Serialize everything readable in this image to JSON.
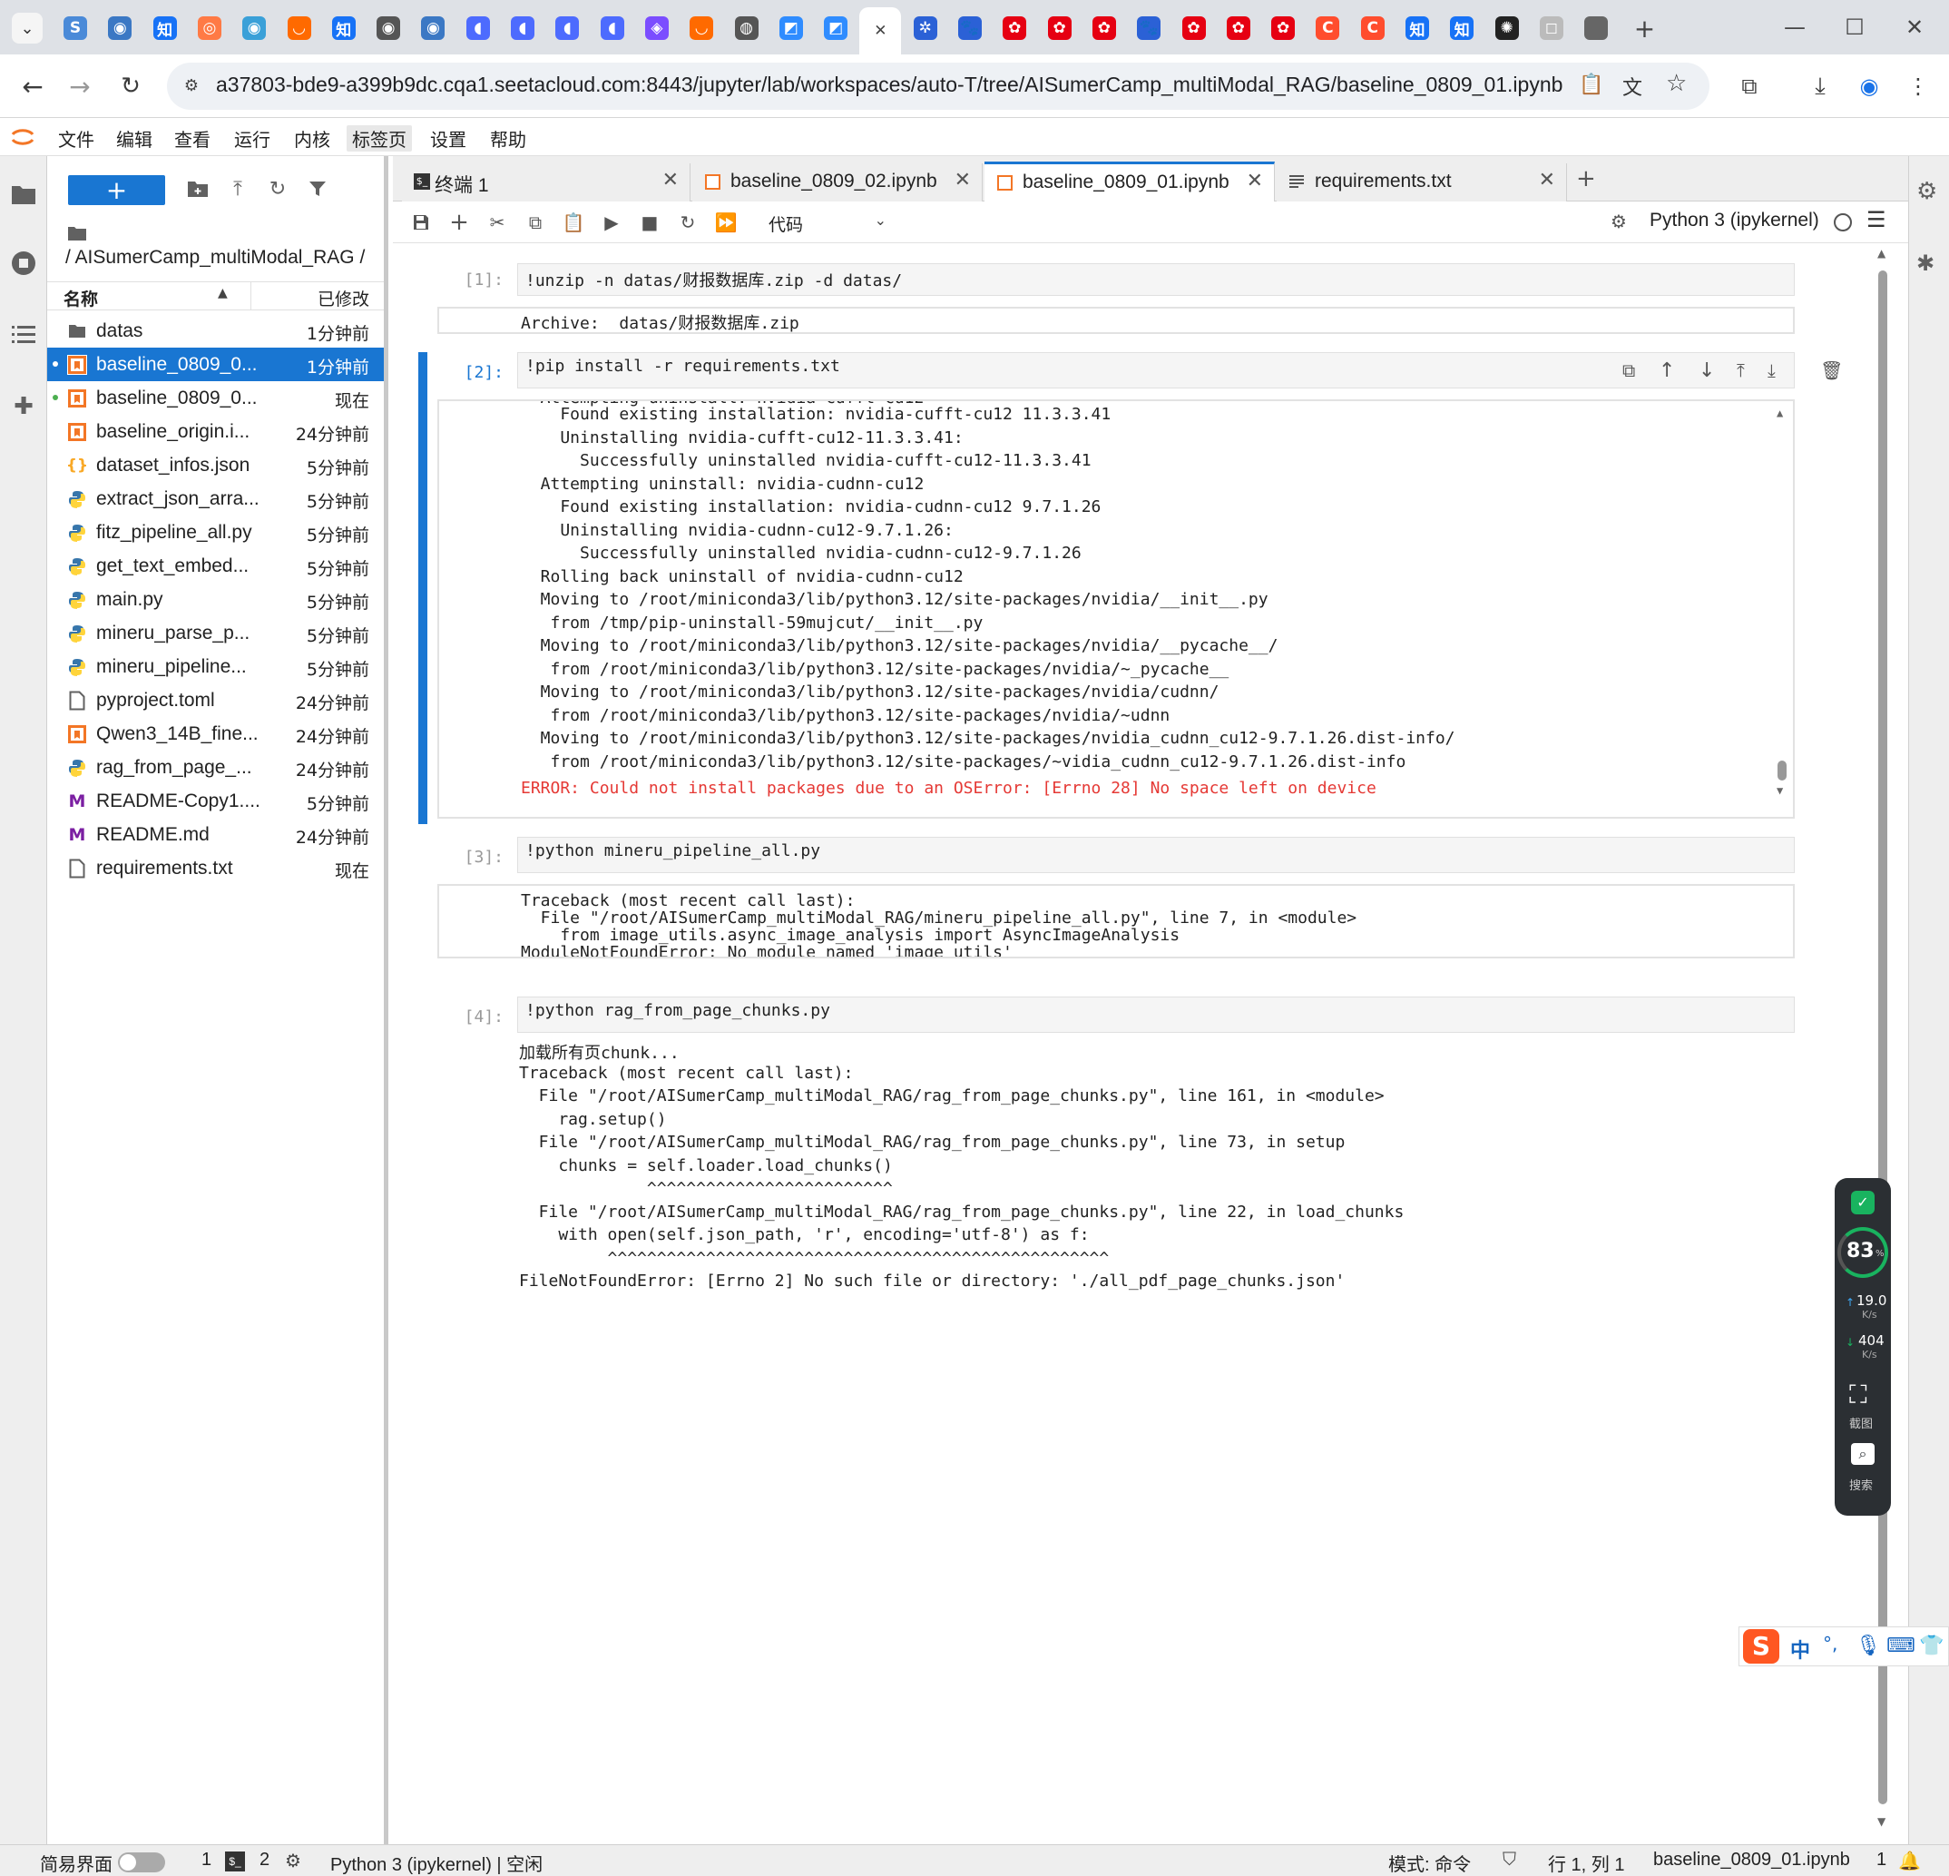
{
  "browser": {
    "url": "a37803-bde9-a399b9dc.cqa1.seetacloud.com:8443/jupyter/lab/workspaces/auto-T/tree/AISumerCamp_multiModal_RAG/baseline_0809_01.ipynb",
    "tabs": [
      {
        "icon": "S",
        "color": "#4a8ad8"
      },
      {
        "icon": "◉",
        "color": "#3b78c4"
      },
      {
        "icon": "知",
        "color": "#1772f6"
      },
      {
        "icon": "◎",
        "color": "#ff7a45"
      },
      {
        "icon": "◉",
        "color": "#3aa0d8"
      },
      {
        "icon": "◡",
        "color": "#ff6a00"
      },
      {
        "icon": "知",
        "color": "#1772f6"
      },
      {
        "icon": "◉",
        "color": "#555555"
      },
      {
        "icon": "◉",
        "color": "#3b78c4"
      },
      {
        "icon": "◖",
        "color": "#4d6bfe"
      },
      {
        "icon": "◖",
        "color": "#4d6bfe"
      },
      {
        "icon": "◖",
        "color": "#4d6bfe"
      },
      {
        "icon": "◖",
        "color": "#4d6bfe"
      },
      {
        "icon": "◈",
        "color": "#7b4dff"
      },
      {
        "icon": "◡",
        "color": "#ff6a00"
      },
      {
        "icon": "◍",
        "color": "#555555"
      },
      {
        "icon": "◩",
        "color": "#2f8cff"
      },
      {
        "icon": "◩",
        "color": "#2f8cff"
      },
      {
        "icon": "✕",
        "color": "#444444"
      },
      {
        "icon": "✲",
        "color": "#2b61d6"
      },
      {
        "icon": "🐾",
        "color": "#2b61d6"
      },
      {
        "icon": "✿",
        "color": "#e60012"
      },
      {
        "icon": "✿",
        "color": "#e60012"
      },
      {
        "icon": "✿",
        "color": "#e60012"
      },
      {
        "icon": "🐾",
        "color": "#2b61d6"
      },
      {
        "icon": "✿",
        "color": "#e60012"
      },
      {
        "icon": "✿",
        "color": "#e60012"
      },
      {
        "icon": "✿",
        "color": "#e60012"
      },
      {
        "icon": "C",
        "color": "#ff4d2e"
      },
      {
        "icon": "C",
        "color": "#ff4d2e"
      },
      {
        "icon": "知",
        "color": "#1772f6"
      },
      {
        "icon": "知",
        "color": "#1772f6"
      },
      {
        "icon": "✺",
        "color": "#222222"
      },
      {
        "icon": "◻",
        "color": "#bbbbbb"
      },
      {
        "icon": "",
        "color": "#666666"
      }
    ],
    "new_tab": "+"
  },
  "menubar": {
    "items": [
      "文件",
      "编辑",
      "查看",
      "运行",
      "内核",
      "标签页",
      "设置",
      "帮助"
    ]
  },
  "filebrowser": {
    "new_label": "+",
    "breadcrumb": "/ AISumerCamp_multiModal_RAG /",
    "col_name": "名称",
    "col_modified": "已修改",
    "files": [
      {
        "name": "datas",
        "modified": "1分钟前",
        "type": "folder",
        "selected": false,
        "running": false
      },
      {
        "name": "baseline_0809_0...",
        "modified": "1分钟前",
        "type": "notebook",
        "selected": true,
        "running": true
      },
      {
        "name": "baseline_0809_0...",
        "modified": "现在",
        "type": "notebook",
        "selected": false,
        "running": true
      },
      {
        "name": "baseline_origin.i...",
        "modified": "24分钟前",
        "type": "notebook",
        "selected": false,
        "running": false
      },
      {
        "name": "dataset_infos.json",
        "modified": "5分钟前",
        "type": "json",
        "selected": false,
        "running": false
      },
      {
        "name": "extract_json_arra...",
        "modified": "5分钟前",
        "type": "python",
        "selected": false,
        "running": false
      },
      {
        "name": "fitz_pipeline_all.py",
        "modified": "5分钟前",
        "type": "python",
        "selected": false,
        "running": false
      },
      {
        "name": "get_text_embed...",
        "modified": "5分钟前",
        "type": "python",
        "selected": false,
        "running": false
      },
      {
        "name": "main.py",
        "modified": "5分钟前",
        "type": "python",
        "selected": false,
        "running": false
      },
      {
        "name": "mineru_parse_p...",
        "modified": "5分钟前",
        "type": "python",
        "selected": false,
        "running": false
      },
      {
        "name": "mineru_pipeline...",
        "modified": "5分钟前",
        "type": "python",
        "selected": false,
        "running": false
      },
      {
        "name": "pyproject.toml",
        "modified": "24分钟前",
        "type": "file",
        "selected": false,
        "running": false
      },
      {
        "name": "Qwen3_14B_fine...",
        "modified": "24分钟前",
        "type": "notebook",
        "selected": false,
        "running": false
      },
      {
        "name": "rag_from_page_...",
        "modified": "24分钟前",
        "type": "python",
        "selected": false,
        "running": false
      },
      {
        "name": "README-Copy1....",
        "modified": "5分钟前",
        "type": "markdown",
        "selected": false,
        "running": false
      },
      {
        "name": "README.md",
        "modified": "24分钟前",
        "type": "markdown",
        "selected": false,
        "running": false
      },
      {
        "name": "requirements.txt",
        "modified": "现在",
        "type": "file",
        "selected": false,
        "running": false
      }
    ]
  },
  "nbtabs": [
    {
      "label": "终端 1",
      "type": "terminal",
      "active": false
    },
    {
      "label": "baseline_0809_02.ipynb",
      "type": "notebook",
      "active": false
    },
    {
      "label": "baseline_0809_01.ipynb",
      "type": "notebook",
      "active": true
    },
    {
      "label": "requirements.txt",
      "type": "text",
      "active": false
    }
  ],
  "nbtoolbar": {
    "cell_type": "代码",
    "kernel": "Python 3 (ipykernel)"
  },
  "cells": {
    "c1": {
      "prompt": "[1]:",
      "input": "!unzip -n datas/财报数据库.zip -d datas/",
      "output": [
        "Archive:  datas/财报数据库.zip"
      ]
    },
    "c2": {
      "prompt": "[2]:",
      "input": "!pip install -r requirements.txt",
      "output_top_partial": "  Attempting uninstall: nvidia-cufft-cu12",
      "output": [
        "    Found existing installation: nvidia-cufft-cu12 11.3.3.41",
        "    Uninstalling nvidia-cufft-cu12-11.3.3.41:",
        "      Successfully uninstalled nvidia-cufft-cu12-11.3.3.41",
        "  Attempting uninstall: nvidia-cudnn-cu12",
        "    Found existing installation: nvidia-cudnn-cu12 9.7.1.26",
        "    Uninstalling nvidia-cudnn-cu12-9.7.1.26:",
        "      Successfully uninstalled nvidia-cudnn-cu12-9.7.1.26",
        "  Rolling back uninstall of nvidia-cudnn-cu12",
        "  Moving to /root/miniconda3/lib/python3.12/site-packages/nvidia/__init__.py",
        "   from /tmp/pip-uninstall-59mujcut/__init__.py",
        "  Moving to /root/miniconda3/lib/python3.12/site-packages/nvidia/__pycache__/",
        "   from /root/miniconda3/lib/python3.12/site-packages/nvidia/~_pycache__",
        "  Moving to /root/miniconda3/lib/python3.12/site-packages/nvidia/cudnn/",
        "   from /root/miniconda3/lib/python3.12/site-packages/nvidia/~udnn",
        "  Moving to /root/miniconda3/lib/python3.12/site-packages/nvidia_cudnn_cu12-9.7.1.26.dist-info/",
        "   from /root/miniconda3/lib/python3.12/site-packages/~vidia_cudnn_cu12-9.7.1.26.dist-info"
      ],
      "error": "ERROR: Could not install packages due to an OSError: [Errno 28] No space left on device"
    },
    "c3": {
      "prompt": "[3]:",
      "input": "!python mineru_pipeline_all.py",
      "output": [
        "Traceback (most recent call last):",
        "  File \"/root/AISumerCamp_multiModal_RAG/mineru_pipeline_all.py\", line 7, in <module>",
        "    from image_utils.async_image_analysis import AsyncImageAnalysis",
        "ModuleNotFoundError: No module named 'image_utils'"
      ]
    },
    "c4": {
      "prompt": "[4]:",
      "input": "!python rag_from_page_chunks.py",
      "output": [
        "加载所有页chunk...",
        "Traceback (most recent call last):",
        "  File \"/root/AISumerCamp_multiModal_RAG/rag_from_page_chunks.py\", line 161, in <module>",
        "    rag.setup()",
        "  File \"/root/AISumerCamp_multiModal_RAG/rag_from_page_chunks.py\", line 73, in setup",
        "    chunks = self.loader.load_chunks()",
        "             ^^^^^^^^^^^^^^^^^^^^^^^^^",
        "  File \"/root/AISumerCamp_multiModal_RAG/rag_from_page_chunks.py\", line 22, in load_chunks",
        "    with open(self.json_path, 'r', encoding='utf-8') as f:",
        "         ^^^^^^^^^^^^^^^^^^^^^^^^^^^^^^^^^^^^^^^^^^^^^^^^^^^",
        "FileNotFoundError: [Errno 2] No such file or directory: './all_pdf_page_chunks.json'"
      ]
    }
  },
  "monitor": {
    "percent": "83",
    "percent_unit": "%",
    "up_value": "19.0",
    "up_unit": "K/s",
    "down_value": "404",
    "down_unit": "K/s",
    "screenshot_label": "截图",
    "search_label": "搜索"
  },
  "ime": {
    "lang": "中",
    "punct": "°,"
  },
  "statusbar": {
    "simple_mode": "简易界面",
    "count1": "1",
    "count2": "2",
    "kernel_status": "Python 3 (ipykernel) | 空闲",
    "mode": "模式: 命令",
    "position": "行 1, 列 1",
    "filename": "baseline_0809_01.ipynb",
    "notifications": "1"
  },
  "colors": {
    "accent": "#1976d2",
    "error": "#e53935"
  }
}
